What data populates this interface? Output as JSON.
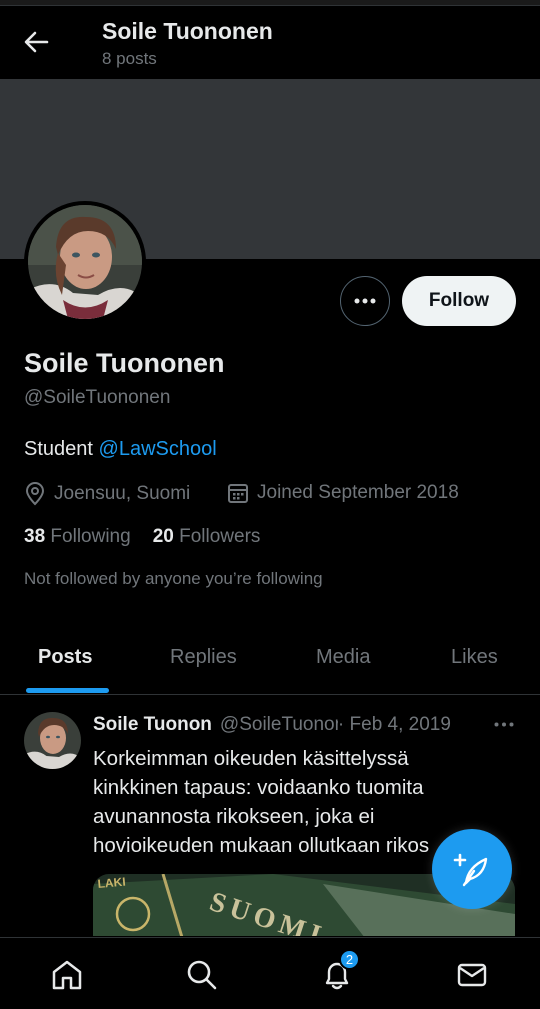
{
  "header": {
    "title": "Soile Tuononen",
    "subtitle": "8 posts"
  },
  "profile": {
    "name": "Soile Tuononen",
    "handle": "@SoileTuononen",
    "bio_text": "Student ",
    "bio_link": "@LawSchool",
    "location": "Joensuu, Suomi",
    "joined": "Joined September 2018",
    "following_count": "38",
    "following_label": "Following",
    "followers_count": "20",
    "followers_label": "Followers",
    "not_followed": "Not followed by anyone you’re following",
    "follow_label": "Follow"
  },
  "tabs": [
    {
      "label": "Posts",
      "active": true
    },
    {
      "label": "Replies",
      "active": false
    },
    {
      "label": "Media",
      "active": false
    },
    {
      "label": "Likes",
      "active": false
    }
  ],
  "post": {
    "name": "Soile Tuonon",
    "handle": "@SoileTuononen",
    "date": "· Feb 4, 2019",
    "lines": [
      "Korkeimman oikeuden käsittelyssä",
      "kinkkinen tapaus: voidaanko tuomita",
      "avunannosta rikokseen, joka ei",
      "hovioikeuden mukaan ollutkaan rikos"
    ],
    "media_text": "SUOMI",
    "media_small": "LAKI"
  },
  "bottom_nav": {
    "items": [
      "home-icon",
      "search-icon",
      "notifications-icon",
      "messages-icon"
    ],
    "notification_badge": "2"
  },
  "colors": {
    "accent": "#1d9bf0",
    "background": "#000000",
    "banner": "#333639",
    "secondary_text": "#71767b"
  }
}
